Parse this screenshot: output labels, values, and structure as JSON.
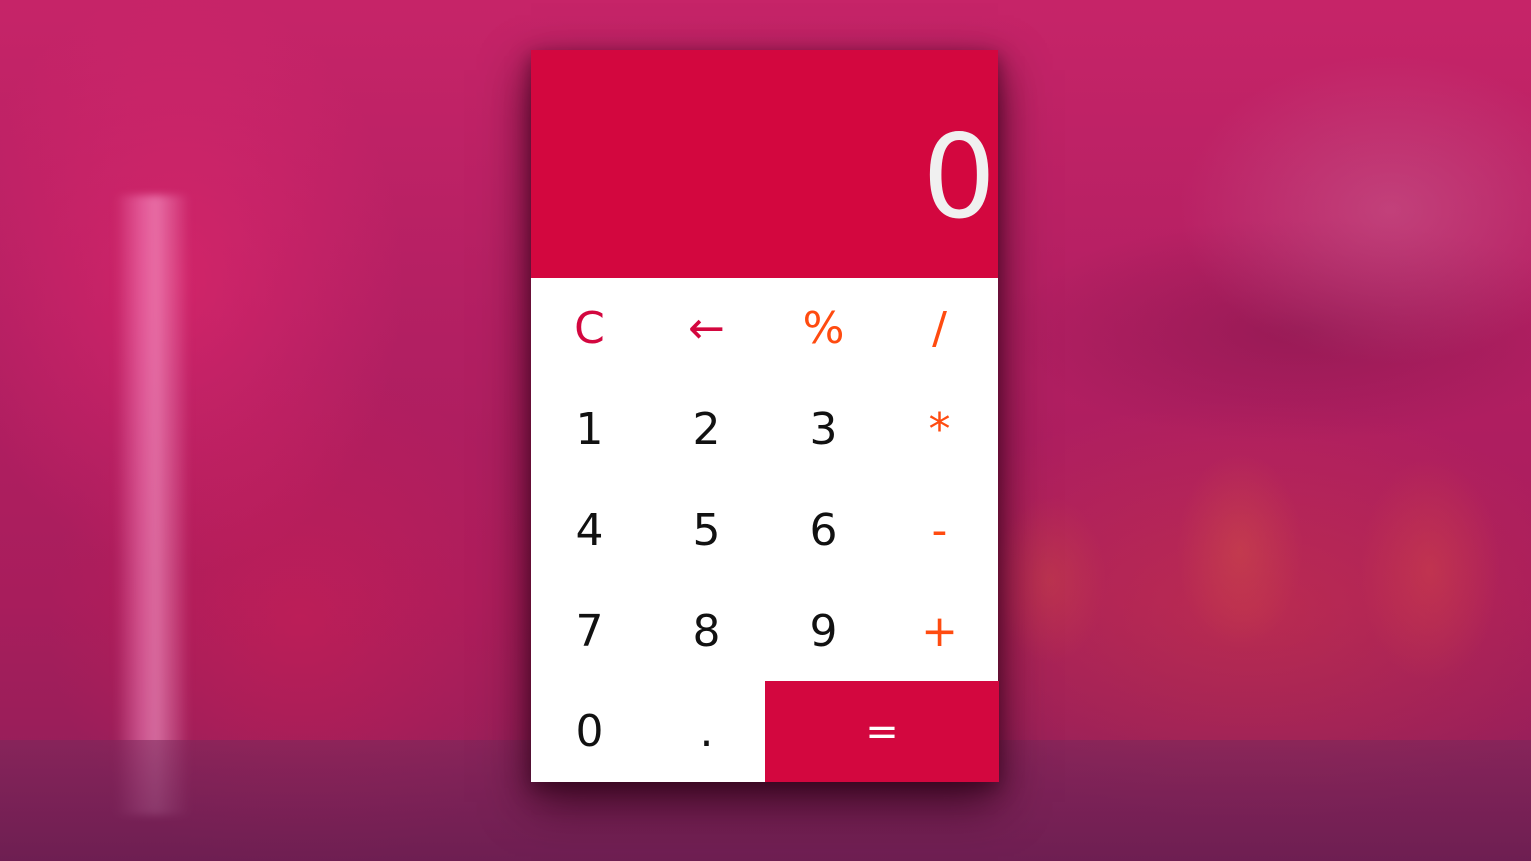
{
  "colors": {
    "display_background": "#d3073f",
    "display_text": "#f0f0f0",
    "keypad_background": "#ffffff",
    "digit_text": "#111111",
    "function_text": "#d3073f",
    "operator_text": "#ff4b10",
    "equals_background": "#d3073f",
    "equals_text": "#ffffff"
  },
  "display": {
    "value": "0"
  },
  "keys": {
    "clear": "C",
    "backspace": "←",
    "percent": "%",
    "divide": "/",
    "one": "1",
    "two": "2",
    "three": "3",
    "multiply": "*",
    "four": "4",
    "five": "5",
    "six": "6",
    "subtract": "-",
    "seven": "7",
    "eight": "8",
    "nine": "9",
    "add": "+",
    "zero": "0",
    "decimal": ".",
    "equals": "="
  }
}
